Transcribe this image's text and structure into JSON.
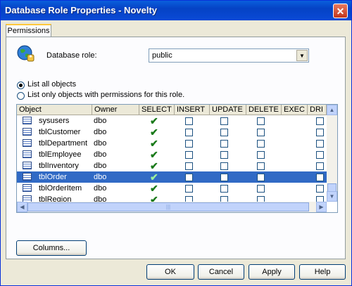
{
  "window": {
    "title": "Database Role Properties - Novelty",
    "close": "✕"
  },
  "tabs": [
    {
      "label": "Permissions"
    }
  ],
  "role": {
    "label": "Database role:",
    "value": "public"
  },
  "filters": {
    "list_all": "List all objects",
    "list_only": "List only objects with permissions for this role.",
    "selected": "list_all"
  },
  "grid": {
    "columns": [
      "Object",
      "Owner",
      "SELECT",
      "INSERT",
      "UPDATE",
      "DELETE",
      "EXEC",
      "DRI"
    ],
    "rows": [
      {
        "object": "sysusers",
        "owner": "dbo",
        "select": true,
        "selected": false
      },
      {
        "object": "tblCustomer",
        "owner": "dbo",
        "select": true,
        "selected": false
      },
      {
        "object": "tblDepartment",
        "owner": "dbo",
        "select": true,
        "selected": false
      },
      {
        "object": "tblEmployee",
        "owner": "dbo",
        "select": true,
        "selected": false
      },
      {
        "object": "tblInventory",
        "owner": "dbo",
        "select": true,
        "selected": false
      },
      {
        "object": "tblOrder",
        "owner": "dbo",
        "select": true,
        "selected": true
      },
      {
        "object": "tblOrderItem",
        "owner": "dbo",
        "select": true,
        "selected": false
      },
      {
        "object": "tblRegion",
        "owner": "dbo",
        "select": true,
        "selected": false
      }
    ]
  },
  "buttons": {
    "columns": "Columns...",
    "ok": "OK",
    "cancel": "Cancel",
    "apply": "Apply",
    "help": "Help"
  },
  "colors": {
    "titlebar": "#0a4ad6",
    "selection": "#316ac5",
    "check": "#1a7a1a"
  }
}
